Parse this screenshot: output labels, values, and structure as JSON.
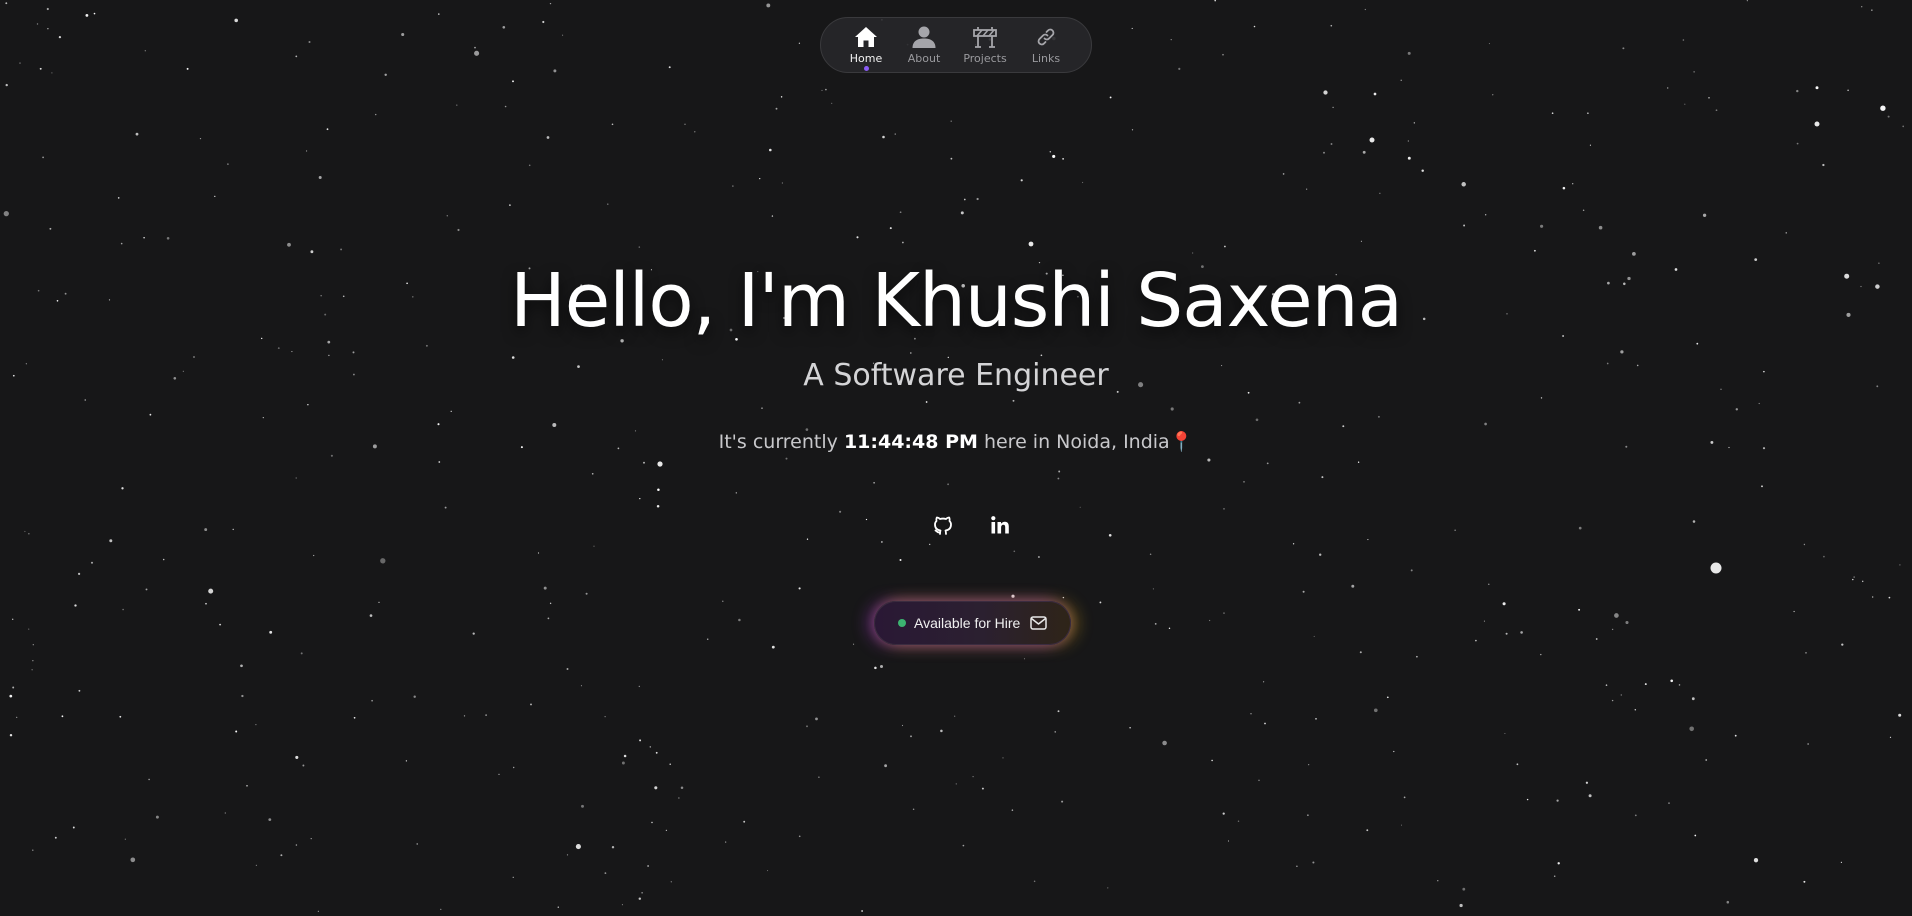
{
  "nav": {
    "items": [
      {
        "label": "Home",
        "icon": "home-icon",
        "active": true
      },
      {
        "label": "About",
        "icon": "user-icon",
        "active": false
      },
      {
        "label": "Projects",
        "icon": "roadblock-icon",
        "active": false
      },
      {
        "label": "Links",
        "icon": "link-icon",
        "active": false
      }
    ],
    "active_indicator_color": "#8b5cf6"
  },
  "hero": {
    "title": "Hello, I'm Khushi Saxena",
    "subtitle": "A Software Engineer",
    "time_prefix": "It's currently",
    "time_value": "11:44:48 PM",
    "time_suffix": "here in Noida, India",
    "location_icon": "📍"
  },
  "social": {
    "links": [
      {
        "name": "GitHub",
        "icon": "github-icon"
      },
      {
        "name": "LinkedIn",
        "icon": "linkedin-icon"
      }
    ]
  },
  "hire_button": {
    "label": "Available for Hire",
    "status_color": "#3cb371",
    "icon": "mail-icon"
  },
  "theme": {
    "background": "#171718",
    "text": "#ffffff",
    "muted_text": "#9a9a9e"
  }
}
